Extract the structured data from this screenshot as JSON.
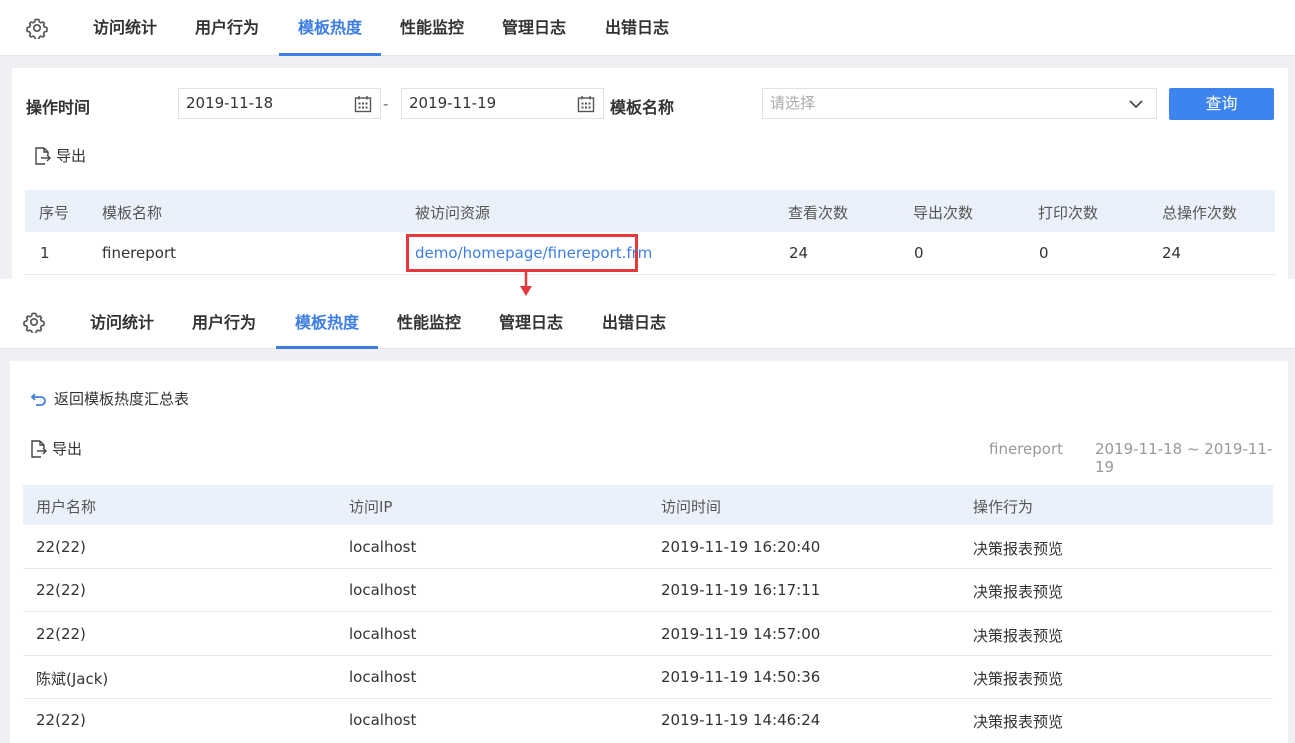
{
  "tabs": [
    {
      "label": "访问统计",
      "active": false
    },
    {
      "label": "用户行为",
      "active": false
    },
    {
      "label": "模板热度",
      "active": true
    },
    {
      "label": "性能监控",
      "active": false
    },
    {
      "label": "管理日志",
      "active": false
    },
    {
      "label": "出错日志",
      "active": false
    }
  ],
  "summary": {
    "filters": {
      "time_label": "操作时间",
      "start_date": "2019-11-18",
      "range_separator": "-",
      "end_date": "2019-11-19",
      "template_label": "模板名称",
      "template_placeholder": "请选择",
      "query_button": "查询"
    },
    "export_label": "导出",
    "columns": [
      "序号",
      "模板名称",
      "被访问资源",
      "查看次数",
      "导出次数",
      "打印次数",
      "总操作次数"
    ],
    "rows": [
      {
        "index": "1",
        "template": "finereport",
        "resource": "demo/homepage/finereport.frm",
        "views": "24",
        "exports": "0",
        "prints": "0",
        "total": "24"
      }
    ]
  },
  "detail": {
    "back_label": "返回模板热度汇总表",
    "export_label": "导出",
    "template_name": "finereport",
    "date_range": "2019-11-18 ~ 2019-11-19",
    "columns": [
      "用户名称",
      "访问IP",
      "访问时间",
      "操作行为"
    ],
    "rows": [
      {
        "user": "22(22)",
        "ip": "localhost",
        "time": "2019-11-19 16:20:40",
        "action": "决策报表预览"
      },
      {
        "user": "22(22)",
        "ip": "localhost",
        "time": "2019-11-19 16:17:11",
        "action": "决策报表预览"
      },
      {
        "user": "22(22)",
        "ip": "localhost",
        "time": "2019-11-19 14:57:00",
        "action": "决策报表预览"
      },
      {
        "user": "陈斌(Jack)",
        "ip": "localhost",
        "time": "2019-11-19 14:50:36",
        "action": "决策报表预览"
      },
      {
        "user": "22(22)",
        "ip": "localhost",
        "time": "2019-11-19 14:46:24",
        "action": "决策报表预览"
      }
    ]
  },
  "colors": {
    "accent": "#3d7ee6",
    "highlight_box": "#e8383d",
    "table_header_bg": "#eaf1fb"
  },
  "icons": {
    "settings": "gear-icon",
    "calendar": "calendar-icon",
    "dropdown": "chevron-down-icon",
    "export": "export-file-icon",
    "back": "back-arrow-icon"
  }
}
